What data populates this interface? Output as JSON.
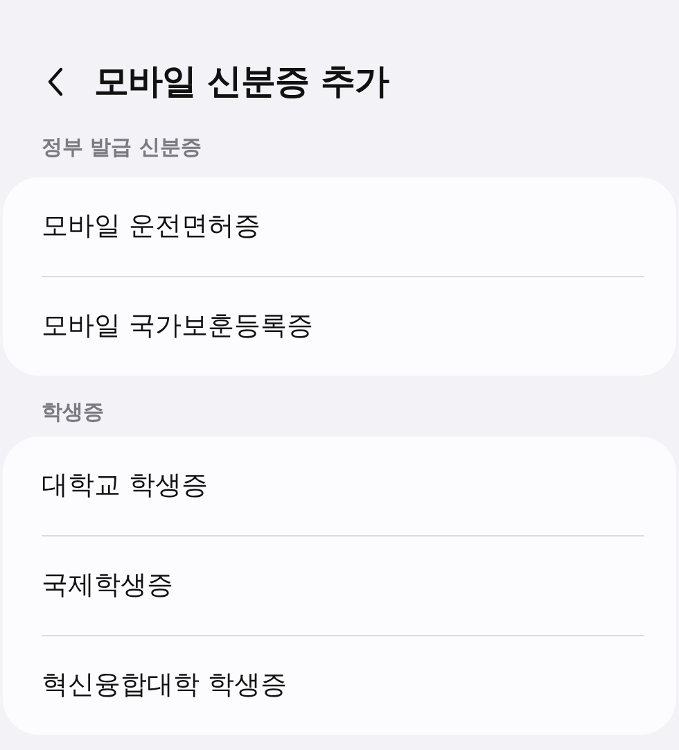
{
  "header": {
    "title": "모바일 신분증 추가"
  },
  "sections": [
    {
      "label": "정부 발급 신분증",
      "items": [
        "모바일 운전면허증",
        "모바일 국가보훈등록증"
      ]
    },
    {
      "label": "학생증",
      "items": [
        "대학교 학생증",
        "국제학생증",
        "혁신융합대학 학생증"
      ]
    }
  ]
}
